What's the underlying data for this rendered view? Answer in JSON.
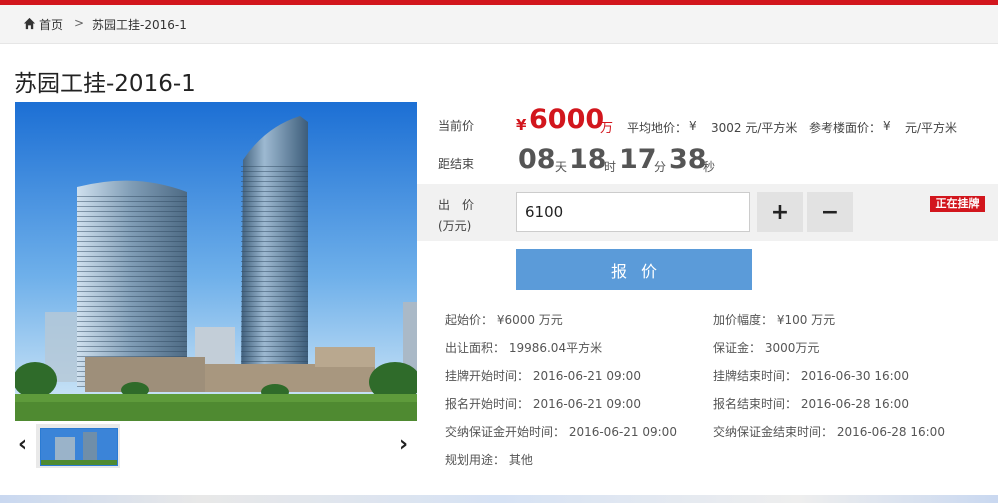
{
  "colors": {
    "accent": "#d2161d",
    "button_blue": "#5b9bd9",
    "badge_red": "#d2161d"
  },
  "breadcrumb": {
    "home": "首页",
    "separator": ">",
    "current": "苏园工挂-2016-1"
  },
  "title": "苏园工挂-2016-1",
  "price": {
    "label": "当前价",
    "currency": "¥",
    "value": "6000",
    "unit": "万",
    "avg_land_label": "平均地价：",
    "avg_land_currency": "¥",
    "avg_land_value": "3002 元/平方米",
    "ref_floor_label": "参考楼面价：",
    "ref_floor_currency": "¥",
    "ref_floor_value": "元/平方米"
  },
  "countdown": {
    "label": "距结束",
    "days": "08",
    "days_unit": "天",
    "hours": "18",
    "hours_unit": "时",
    "minutes": "17",
    "minutes_unit": "分",
    "seconds": "38",
    "seconds_unit": "秒"
  },
  "bid": {
    "label_line1": "出　价",
    "label_line2": "(万元)",
    "value": "6100",
    "plus": "+",
    "minus": "−"
  },
  "status_badge": "正在挂牌",
  "quote_button": "报价",
  "details": {
    "start_price": "起始价： ¥6000  万元",
    "increment": "加价幅度： ¥100  万元",
    "area": "出让面积： 19986.04平方米",
    "deposit": "保证金： 3000万元",
    "listing_start": "挂牌开始时间： 2016-06-21 09:00",
    "listing_end": "挂牌结束时间： 2016-06-30 16:00",
    "signup_start": "报名开始时间： 2016-06-21 09:00",
    "signup_end": "报名结束时间： 2016-06-28 16:00",
    "deposit_start": "交纳保证金开始时间： 2016-06-21 09:00",
    "deposit_end": "交纳保证金结束时间： 2016-06-28 16:00",
    "usage": "规划用途： 其他"
  },
  "gallery": {
    "prev_icon": "chevron-left-icon",
    "next_icon": "chevron-right-icon",
    "prev": "‹",
    "next": "›"
  }
}
